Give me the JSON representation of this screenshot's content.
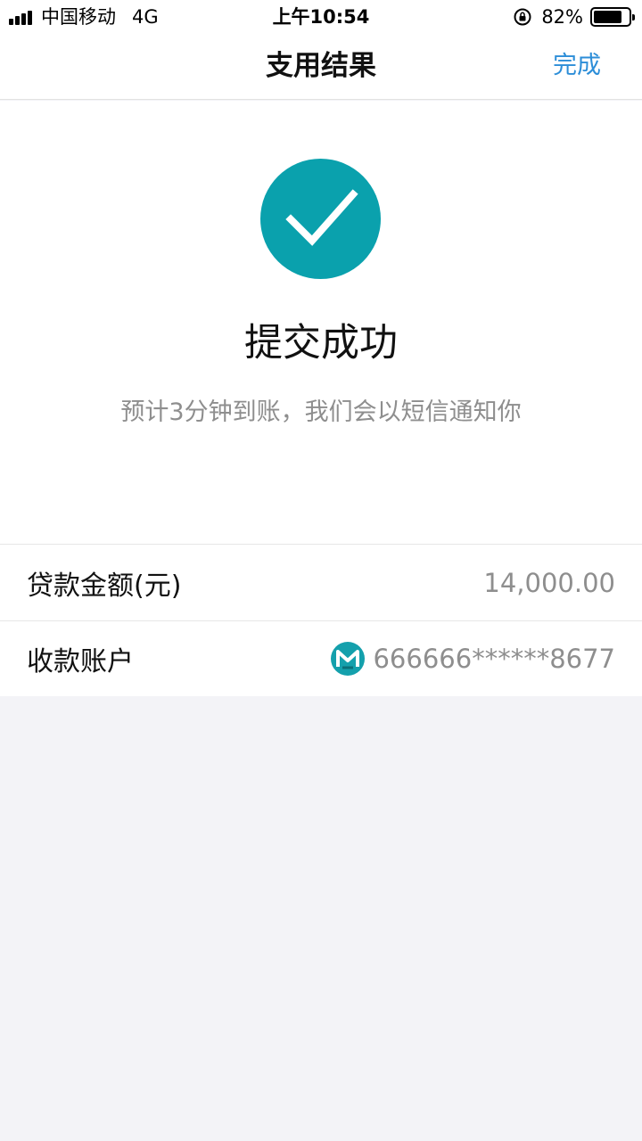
{
  "status_bar": {
    "carrier": "中国移动",
    "network": "4G",
    "time": "上午10:54",
    "battery_percent": "82%",
    "battery_level": 0.82
  },
  "nav": {
    "title": "支用结果",
    "done_label": "完成"
  },
  "result": {
    "icon": "check-icon",
    "accent_color": "#0aa1ad",
    "title": "提交成功",
    "subtitle": "预计3分钟到账，我们会以短信通知你"
  },
  "details": [
    {
      "label": "贷款金额(元)",
      "value": "14,000.00"
    },
    {
      "label": "收款账户",
      "value": "666666******8677",
      "icon": "bank-logo-icon"
    }
  ]
}
